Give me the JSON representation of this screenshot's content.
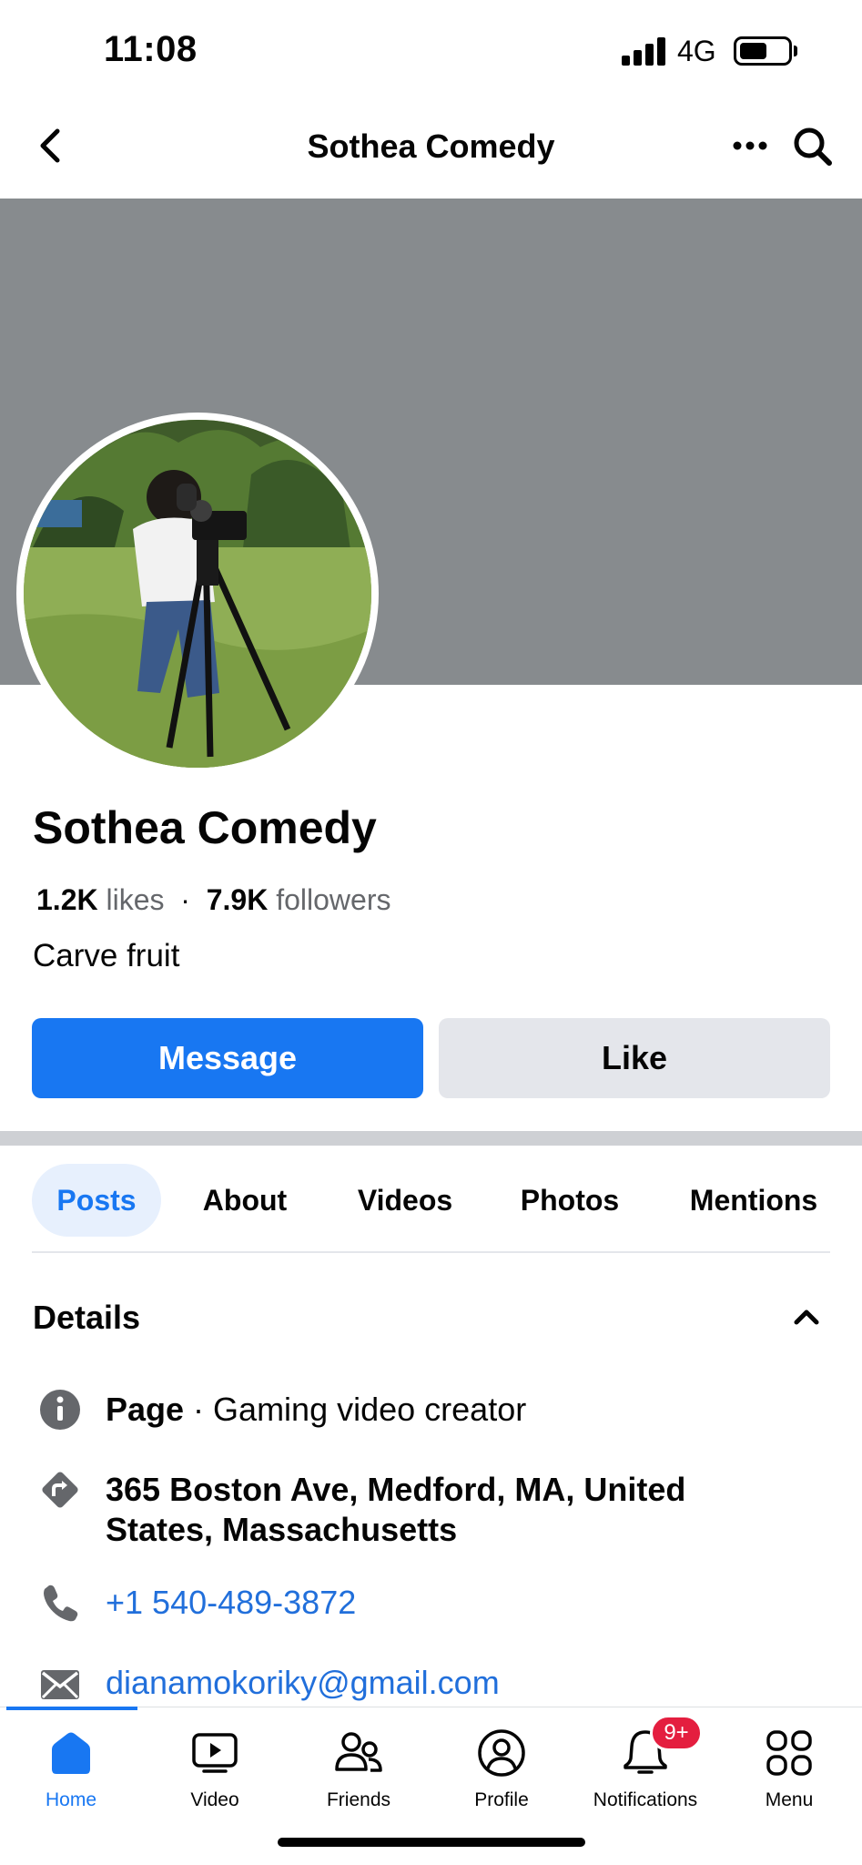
{
  "status_bar": {
    "time": "11:08",
    "network": "4G",
    "battery_level": 0.55
  },
  "top_nav": {
    "title": "Sothea Comedy"
  },
  "profile": {
    "name": "Sothea Comedy",
    "likes_count": "1.2K",
    "likes_label": "likes",
    "separator": "·",
    "followers_count": "7.9K",
    "followers_label": "followers",
    "bio": "Carve fruit"
  },
  "actions": {
    "message_label": "Message",
    "like_label": "Like"
  },
  "tabs": [
    {
      "label": "Posts",
      "active": true
    },
    {
      "label": "About",
      "active": false
    },
    {
      "label": "Videos",
      "active": false
    },
    {
      "label": "Photos",
      "active": false
    },
    {
      "label": "Mentions",
      "active": false
    }
  ],
  "details": {
    "title": "Details",
    "page_label": "Page",
    "page_category": " · Gaming video creator",
    "address_line1": "365 Boston Ave, Medford, MA, United",
    "address_line2": "States, Massachusetts",
    "phone": "+1 540-489-3872",
    "email": "dianamokoriky@gmail.com"
  },
  "bottom_nav": {
    "items": [
      {
        "label": "Home",
        "icon": "home-icon",
        "active": true
      },
      {
        "label": "Video",
        "icon": "video-icon",
        "active": false
      },
      {
        "label": "Friends",
        "icon": "friends-icon",
        "active": false
      },
      {
        "label": "Profile",
        "icon": "profile-icon",
        "active": false
      },
      {
        "label": "Notifications",
        "icon": "bell-icon",
        "active": false
      },
      {
        "label": "Menu",
        "icon": "menu-grid-icon",
        "active": false
      }
    ],
    "notification_badge": "9+"
  },
  "colors": {
    "accent": "#1877f2",
    "cover": "#878b8e",
    "link": "#216fdb",
    "badge": "#e41e3f"
  }
}
